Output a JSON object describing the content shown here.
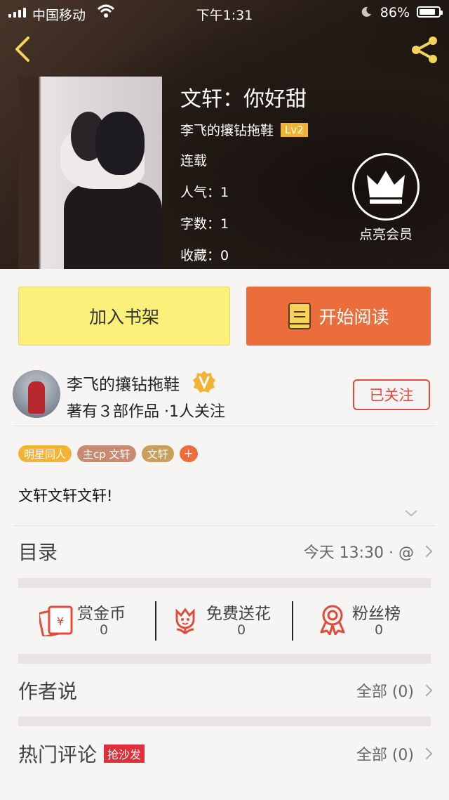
{
  "status_bar": {
    "carrier": "中国移动",
    "time": "下午1:31",
    "battery": "86%",
    "battery_level": 0.86
  },
  "book": {
    "title": "文轩：你好甜",
    "author": "李飞的攘钻拖鞋",
    "level": "Lv2",
    "status": "连载",
    "popularity": "人气：1",
    "word_count": "字数：1",
    "favorites": "收藏：0"
  },
  "vip": {
    "label": "点亮会员"
  },
  "actions": {
    "add_shelf": "加入书架",
    "start_read": "开始阅读"
  },
  "author_card": {
    "name": "李飞的攘钻拖鞋",
    "sub": "著有３部作品 ·1人关注",
    "follow_label": "已关注"
  },
  "tags": [
    {
      "label": "明星同人",
      "color": "#f0b333"
    },
    {
      "label": "主cp 文轩",
      "color": "#c98a72"
    },
    {
      "label": "文轩",
      "color": "#c9a05b"
    }
  ],
  "tag_more": "+",
  "description": "文轩文轩文轩!",
  "catalog": {
    "title": "目录",
    "updated": "今天 13:30 · @"
  },
  "stats": [
    {
      "label": "赏金币",
      "value": "0",
      "icon": "red-envelope-icon"
    },
    {
      "label": "免费送花",
      "value": "0",
      "icon": "flower-icon"
    },
    {
      "label": "粉丝榜",
      "value": "0",
      "icon": "ribbon-medal-icon"
    }
  ],
  "author_says": {
    "title": "作者说",
    "right": "全部 (0)"
  },
  "hot_comments": {
    "title": "热门评论",
    "badge": "抢沙发",
    "right": "全部 (0)"
  },
  "colors": {
    "accent_orange": "#ec6d3c",
    "shelf_yellow": "#fbf07a",
    "follow_red": "#e04b3c",
    "level_gold": "#f0b333"
  }
}
